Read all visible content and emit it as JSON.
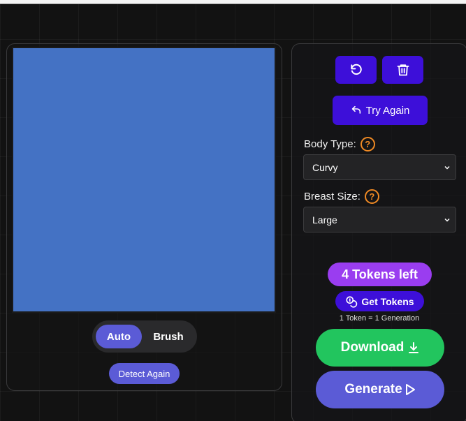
{
  "editor": {
    "canvas_color": "#4472c4",
    "modes": {
      "auto_label": "Auto",
      "brush_label": "Brush",
      "selected": "Auto"
    },
    "detect_again_label": "Detect Again"
  },
  "controls": {
    "icons": {
      "undo": "rotate-ccw-icon",
      "delete": "trash-icon"
    },
    "try_again_label": "Try Again",
    "body_type": {
      "label": "Body Type:",
      "help": "?",
      "value": "Curvy"
    },
    "breast_size": {
      "label": "Breast Size:",
      "help": "?",
      "value": "Large"
    },
    "tokens_left_label": "4 Tokens left",
    "get_tokens_label": "Get Tokens",
    "token_note": "1 Token = 1 Generation",
    "download_label": "Download",
    "generate_label": "Generate"
  },
  "colors": {
    "accent": "#3d0fd9",
    "secondary": "#5b5bd6",
    "tokens": "#9a3df0",
    "success": "#22c55e",
    "help": "#f08a24"
  }
}
